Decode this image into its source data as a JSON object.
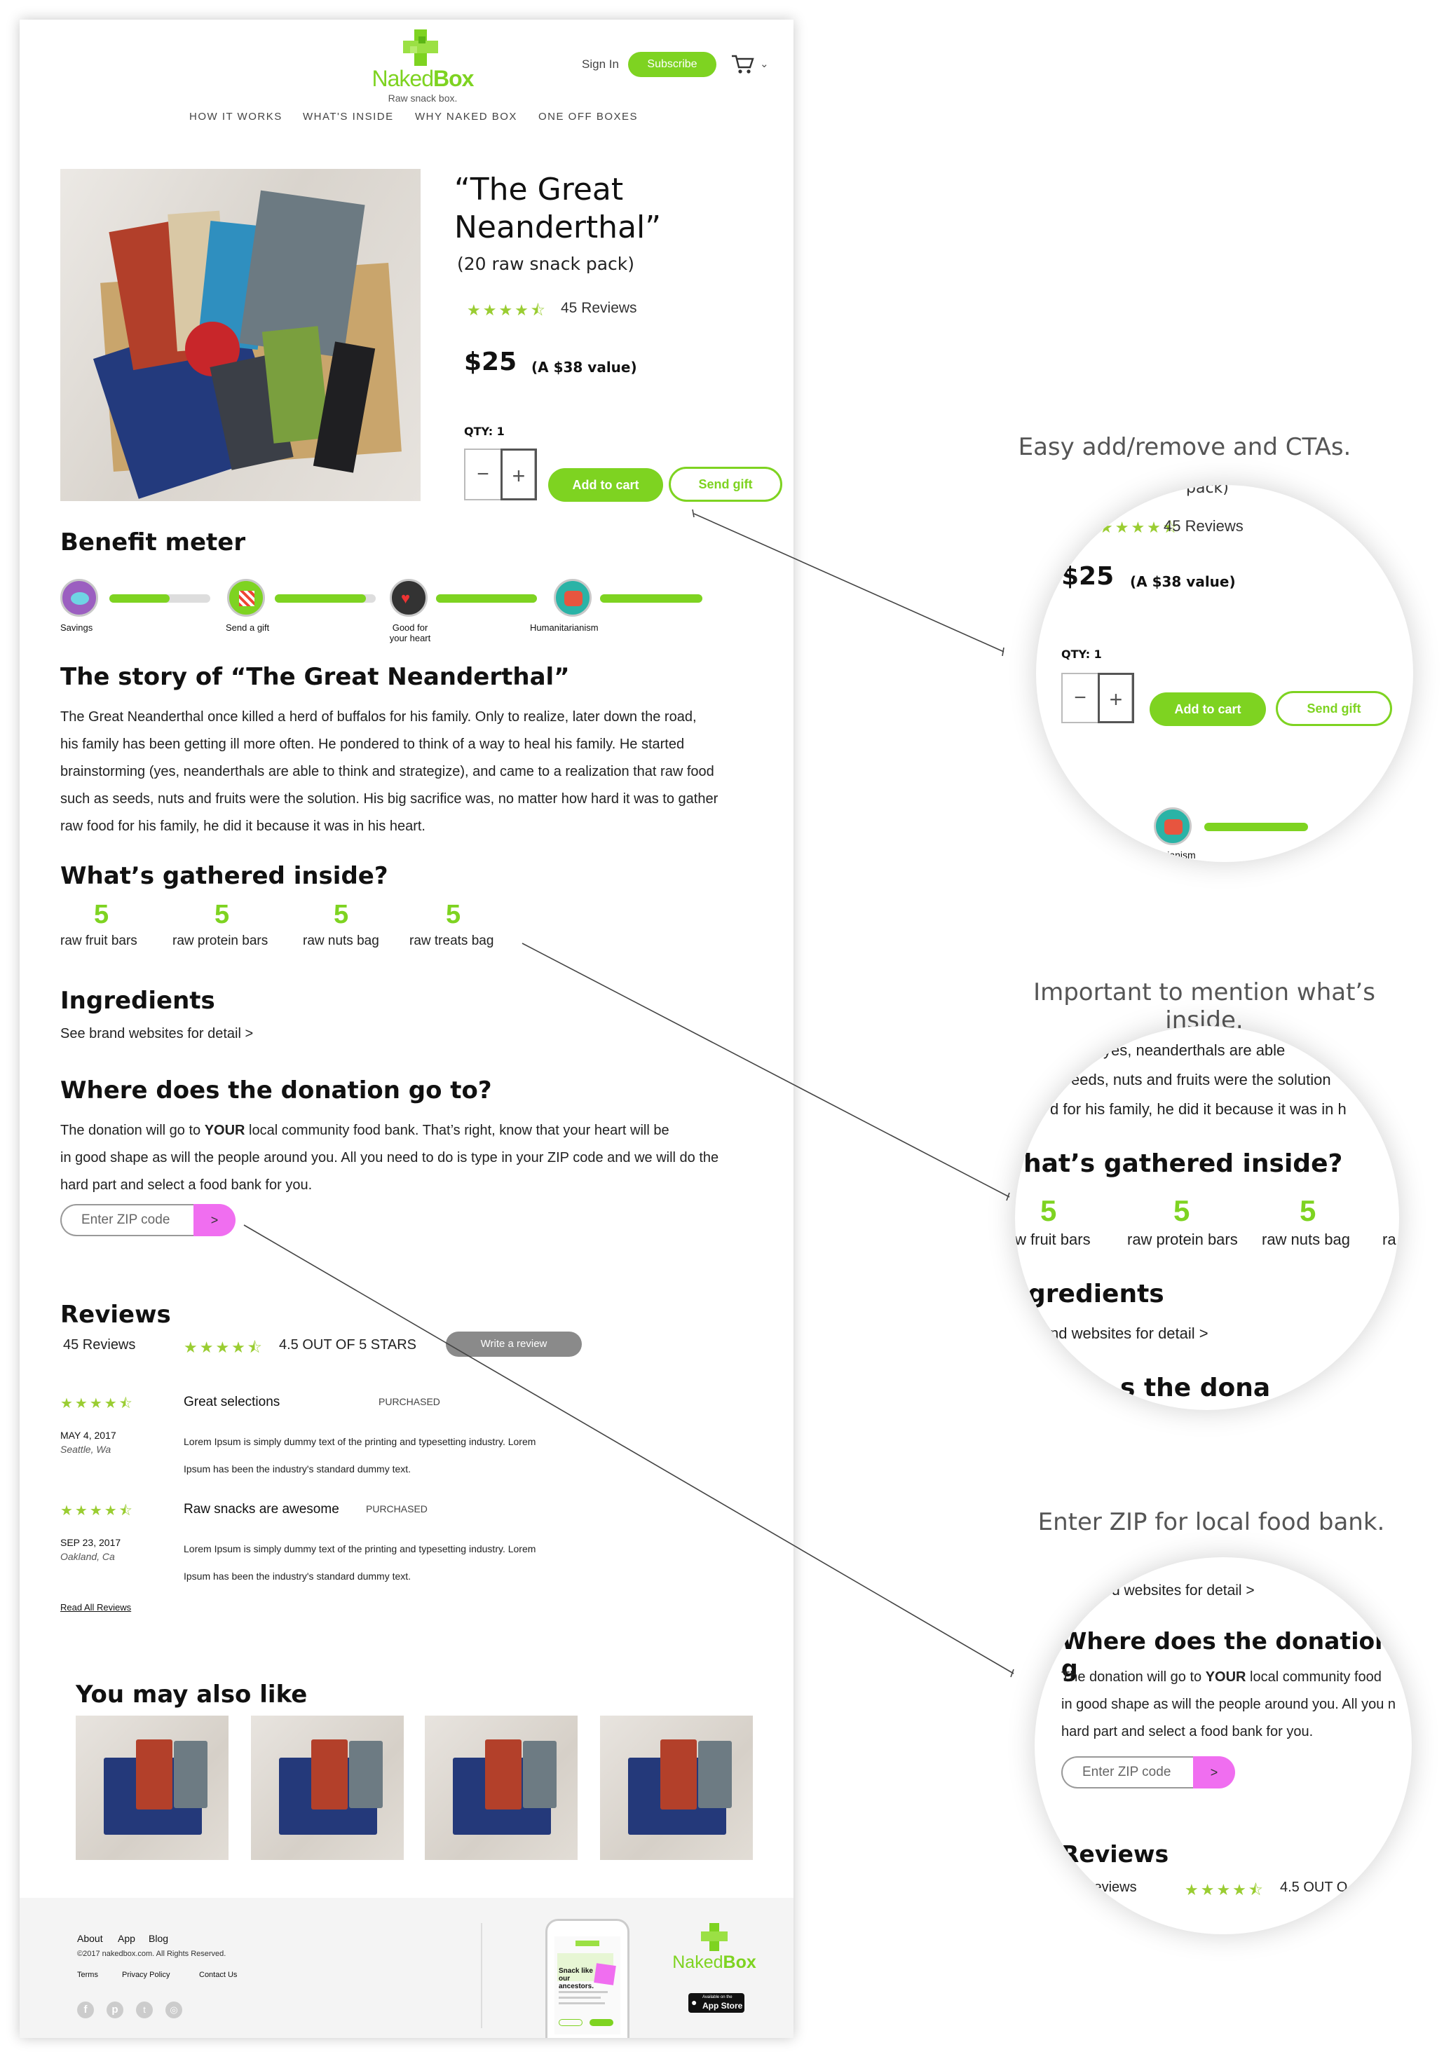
{
  "brand": {
    "name_a": "Naked",
    "name_b": "Box",
    "tagline": "Raw snack box."
  },
  "header": {
    "sign_in": "Sign In",
    "subscribe": "Subscribe"
  },
  "nav": [
    "HOW IT WORKS",
    "WHAT'S INSIDE",
    "WHY NAKED BOX",
    "ONE OFF BOXES"
  ],
  "product": {
    "title_line1": "“The Great",
    "title_line2": "Neanderthal”",
    "subtitle": "(20 raw snack pack)",
    "stars": "★★★★⯪",
    "reviews": "45 Reviews",
    "price": "$25",
    "value": "(A $38 value)",
    "qty_label": "QTY: 1",
    "minus": "−",
    "plus": "+",
    "add_to_cart": "Add to cart",
    "send_gift": "Send gift"
  },
  "benefit": {
    "title": "Benefit meter",
    "items": [
      {
        "label": "Savings",
        "fill": 0.6
      },
      {
        "label": "Send a gift",
        "fill": 0.9
      },
      {
        "label": "Good for your heart",
        "fill": 1.0
      },
      {
        "label": "Humanitarianism",
        "fill": 1.0
      }
    ]
  },
  "story": {
    "title": "The story of “The Great Neanderthal”",
    "lines": [
      "The Great Neanderthal once killed a herd of buffalos for his family. Only to realize, later down the road,",
      "his family has been getting ill more often. He pondered to think of a way to heal his family. He started",
      "brainstorming (yes, neanderthals are able to think and strategize), and came to a realization that raw food",
      "such as seeds, nuts and fruits were the solution. His big sacrifice was, no matter how hard it was to gather",
      "raw food for his family, he did it because it was in his heart."
    ]
  },
  "inside": {
    "title": "What’s gathered inside?",
    "items": [
      {
        "count": "5",
        "label": "raw fruit bars"
      },
      {
        "count": "5",
        "label": "raw protein bars"
      },
      {
        "count": "5",
        "label": "raw nuts bag"
      },
      {
        "count": "5",
        "label": "raw treats bag"
      }
    ]
  },
  "ingredients": {
    "title": "Ingredients",
    "link": "See brand websites for detail >"
  },
  "donation": {
    "title": "Where does the donation go to?",
    "line1_a": "The donation will go to ",
    "line1_b": "YOUR",
    "line1_c": " local community food bank. That’s right, know that your heart will be",
    "line2": "in good shape as will the people around you. All you need to do is type in your ZIP code and we will do the",
    "line3": "hard part and select a food bank for you.",
    "zip_placeholder": "Enter ZIP code",
    "zip_go": ">"
  },
  "reviews": {
    "title": "Reviews",
    "count": "45 Reviews",
    "stars": "★★★★⯪",
    "summary": "4.5 OUT OF 5 STARS",
    "write": "Write a review",
    "items": [
      {
        "stars": "★★★★⯪",
        "date": "MAY 4, 2017",
        "loc": "Seattle, Wa",
        "title": "Great selections",
        "badge": "PURCHASED",
        "line1": "Lorem Ipsum is simply dummy text of the printing and typesetting industry. Lorem",
        "line2": "Ipsum has been the industry's standard dummy text."
      },
      {
        "stars": "★★★★⯪",
        "date": "SEP 23, 2017",
        "loc": "Oakland, Ca",
        "title": "Raw snacks are awesome",
        "badge": "PURCHASED",
        "line1": "Lorem Ipsum is simply dummy text of the printing and typesetting industry. Lorem",
        "line2": "Ipsum has been the industry's standard dummy text."
      }
    ],
    "read_all": "Read All Reviews"
  },
  "also_like": {
    "title": "You may also like"
  },
  "footer": {
    "links": [
      "About",
      "App",
      "Blog"
    ],
    "copyright": "©2017 nakedbox.com. All Rights Reserved.",
    "legal": [
      "Terms",
      "Privacy Policy",
      "Contact Us"
    ],
    "phone_headline": "Snack like our ancestors.",
    "app_store": "App Store",
    "app_store_small": "Available on the"
  },
  "callouts": [
    "Easy add/remove and CTAs.",
    "Important to mention what’s inside.",
    "Enter ZIP for local food bank."
  ],
  "zoom1": {
    "partial_top": "pack)",
    "partial_bottom": "nitarianism"
  },
  "zoom2": {
    "l1": "yes, neanderthals are able",
    "l2": "eeds, nuts and fruits were the solution",
    "l3": "d for his family, he did it because it was in h",
    "title": "hat’s gathered inside?",
    "i1": "w fruit bars",
    "i2": "raw protein bars",
    "i3": "raw nuts bag",
    "i4": "ra",
    "ing": "gredients",
    "link": "nd websites for detail >",
    "bottom": "s the dona"
  },
  "zoom3": {
    "top": "d websites for detail >",
    "title": "Where does the donation g",
    "l1a": "The donation will go to ",
    "l1b": "YOUR",
    "l1c": " local community food",
    "l2": "in good shape as will the people around you. All you n",
    "l3": "hard part and select a food bank for you.",
    "reviews_title": "Reviews",
    "rev_count": "Reviews",
    "summary": "4.5 OUT O"
  },
  "colors": {
    "accent": "#7ed321",
    "zip_btn": "#f06ef0",
    "write_btn": "#8a8a8a"
  }
}
